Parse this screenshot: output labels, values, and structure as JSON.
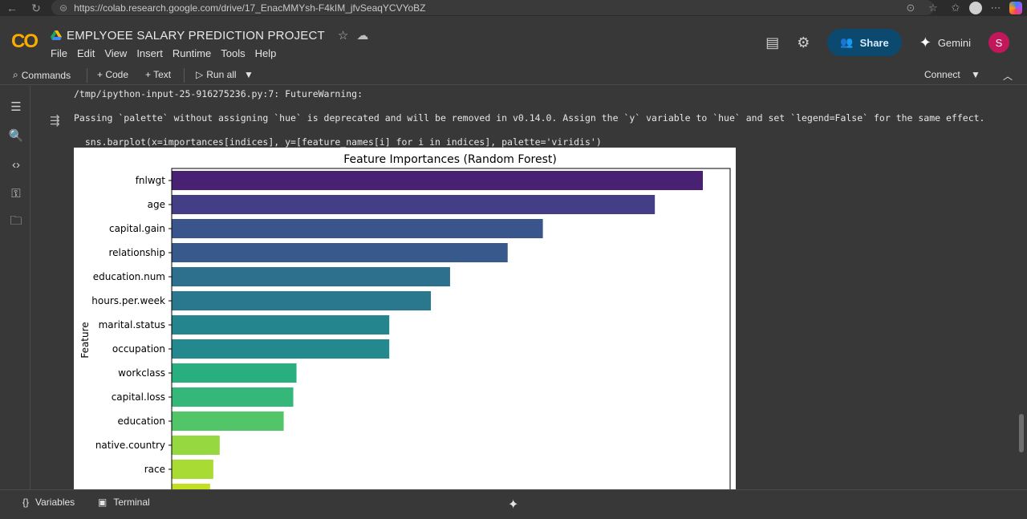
{
  "browser": {
    "url": "https://colab.research.google.com/drive/17_EnacMMYsh-F4kIM_jfvSeaqYCVYoBZ"
  },
  "header": {
    "logo": "CO",
    "title": "EMPLYOEE SALARY PREDICTION PROJECT",
    "menu": [
      "File",
      "Edit",
      "View",
      "Insert",
      "Runtime",
      "Tools",
      "Help"
    ],
    "share_label": "Share",
    "gemini_label": "Gemini",
    "user_initial": "S"
  },
  "toolbar": {
    "commands": "Commands",
    "code": "+ Code",
    "text": "+ Text",
    "run_all": "Run all",
    "connect": "Connect"
  },
  "output": {
    "line1": "/tmp/ipython-input-25-916275236.py:7: FutureWarning:",
    "line2": "Passing `palette` without assigning `hue` is deprecated and will be removed in v0.14.0. Assign the `y` variable to `hue` and set `legend=False` for the same effect.",
    "line3": "  sns.barplot(x=importances[indices], y=[feature_names[i] for i in indices], palette='viridis')"
  },
  "chart_data": {
    "type": "bar",
    "orientation": "horizontal",
    "title": "Feature Importances (Random Forest)",
    "ylabel": "Feature",
    "xlabel": "",
    "categories": [
      "fnlwgt",
      "age",
      "capital.gain",
      "relationship",
      "education.num",
      "hours.per.week",
      "marital.status",
      "occupation",
      "workclass",
      "capital.loss",
      "education",
      "native.country",
      "race",
      ""
    ],
    "values": [
      0.166,
      0.151,
      0.116,
      0.105,
      0.087,
      0.081,
      0.068,
      0.068,
      0.039,
      0.038,
      0.035,
      0.015,
      0.013,
      0.012
    ],
    "xlim": [
      0,
      0.175
    ],
    "palette": "viridis",
    "colors": [
      "#482173",
      "#433e85",
      "#3a548c",
      "#38598c",
      "#2d708e",
      "#2a788e",
      "#25858e",
      "#23898e",
      "#29af7f",
      "#35b779",
      "#52c569",
      "#95d840",
      "#a8db34",
      "#c2df23"
    ]
  },
  "bottombar": {
    "variables": "Variables",
    "terminal": "Terminal"
  }
}
